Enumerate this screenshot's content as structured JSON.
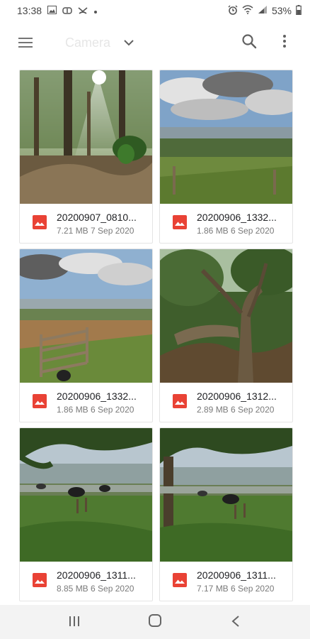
{
  "status": {
    "time": "13:38",
    "battery": "53%",
    "icons_left": [
      "gallery-icon",
      "link-icon",
      "missed-call-icon",
      "dot-icon"
    ],
    "icons_right": [
      "alarm-icon",
      "wifi-icon",
      "signal-icon",
      "battery-icon"
    ]
  },
  "toolbar": {
    "folder_title": "Camera",
    "menu_icon": "hamburger-menu-icon",
    "dropdown_icon": "chevron-down-icon",
    "search_icon": "search-icon",
    "more_icon": "more-vert-icon"
  },
  "files": [
    {
      "name": "20200907_0810...",
      "detail": "7.21 MB 7 Sep 2020",
      "icon": "image-file-icon",
      "scene": "forest-sunbeam"
    },
    {
      "name": "20200906_1332...",
      "detail": "1.86 MB 6 Sep 2020",
      "icon": "image-file-icon",
      "scene": "cloudy-valley"
    },
    {
      "name": "20200906_1332...",
      "detail": "1.86 MB 6 Sep 2020",
      "icon": "image-file-icon",
      "scene": "gate-field"
    },
    {
      "name": "20200906_1312...",
      "detail": "2.89 MB 6 Sep 2020",
      "icon": "image-file-icon",
      "scene": "twisted-tree"
    },
    {
      "name": "20200906_1311...",
      "detail": "8.85 MB 6 Sep 2020",
      "icon": "image-file-icon",
      "scene": "cows-under-tree"
    },
    {
      "name": "20200906_1311...",
      "detail": "7.17 MB 6 Sep 2020",
      "icon": "image-file-icon",
      "scene": "cows-under-tree"
    }
  ],
  "navbar": {
    "recents_icon": "recents-icon",
    "home_icon": "home-icon",
    "back_icon": "back-icon"
  },
  "colors": {
    "file_icon_red": "#e94235",
    "detail_gray": "#7a7a7a"
  }
}
